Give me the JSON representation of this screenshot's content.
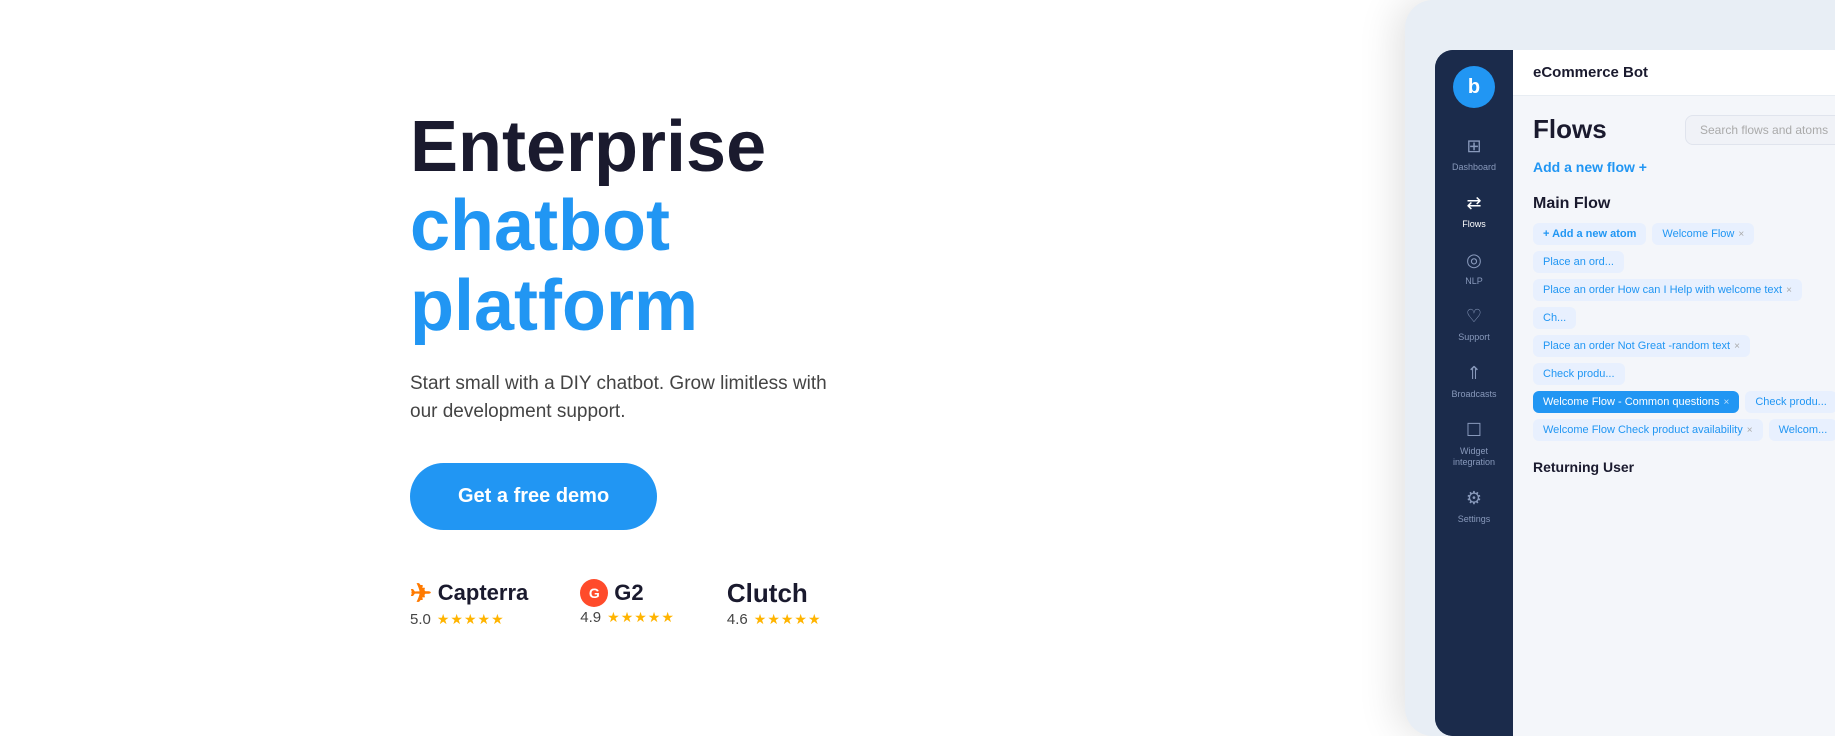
{
  "headline": {
    "line1": "Enterprise",
    "line2": "chatbot platform"
  },
  "subtitle": "Start small with a DIY chatbot. Grow limitless with our development support.",
  "cta": {
    "label": "Get a free demo"
  },
  "ratings": [
    {
      "name": "Capterra",
      "score": "5.0",
      "stars": "★★★★★",
      "icon_type": "capterra"
    },
    {
      "name": "G2",
      "score": "4.9",
      "stars": "★★★★★",
      "icon_type": "g2"
    },
    {
      "name": "Clutch",
      "score": "4.6",
      "stars": "★★★★★",
      "icon_type": "clutch"
    }
  ],
  "app": {
    "bot_name": "eCommerce Bot",
    "sidebar": [
      {
        "label": "Dashboard",
        "icon": "⊞"
      },
      {
        "label": "Flows",
        "icon": "⇄"
      },
      {
        "label": "NLP",
        "icon": "◎"
      },
      {
        "label": "Support",
        "icon": "🎧"
      },
      {
        "label": "Broadcasts",
        "icon": "↟"
      },
      {
        "label": "Widget integration",
        "icon": "☐"
      },
      {
        "label": "Settings",
        "icon": "⚙"
      }
    ],
    "flows_title": "Flows",
    "search_placeholder": "Search flows and atoms",
    "add_flow_label": "Add a new flow +",
    "main_flow": {
      "title": "Main Flow",
      "rows": [
        [
          "+ Add a new atom",
          "Welcome Flow ×",
          "Place an ord..."
        ],
        [
          "Place an order How can I Help with welcome text ×",
          "Ch..."
        ],
        [
          "Place an order Not Great -random text ×",
          "Check produ..."
        ],
        [
          "Welcome Flow - Common questions ×",
          "Check produ..."
        ],
        [
          "Welcome Flow Check product availability ×",
          "Welcom..."
        ]
      ]
    },
    "returning_user": "Returning User"
  }
}
